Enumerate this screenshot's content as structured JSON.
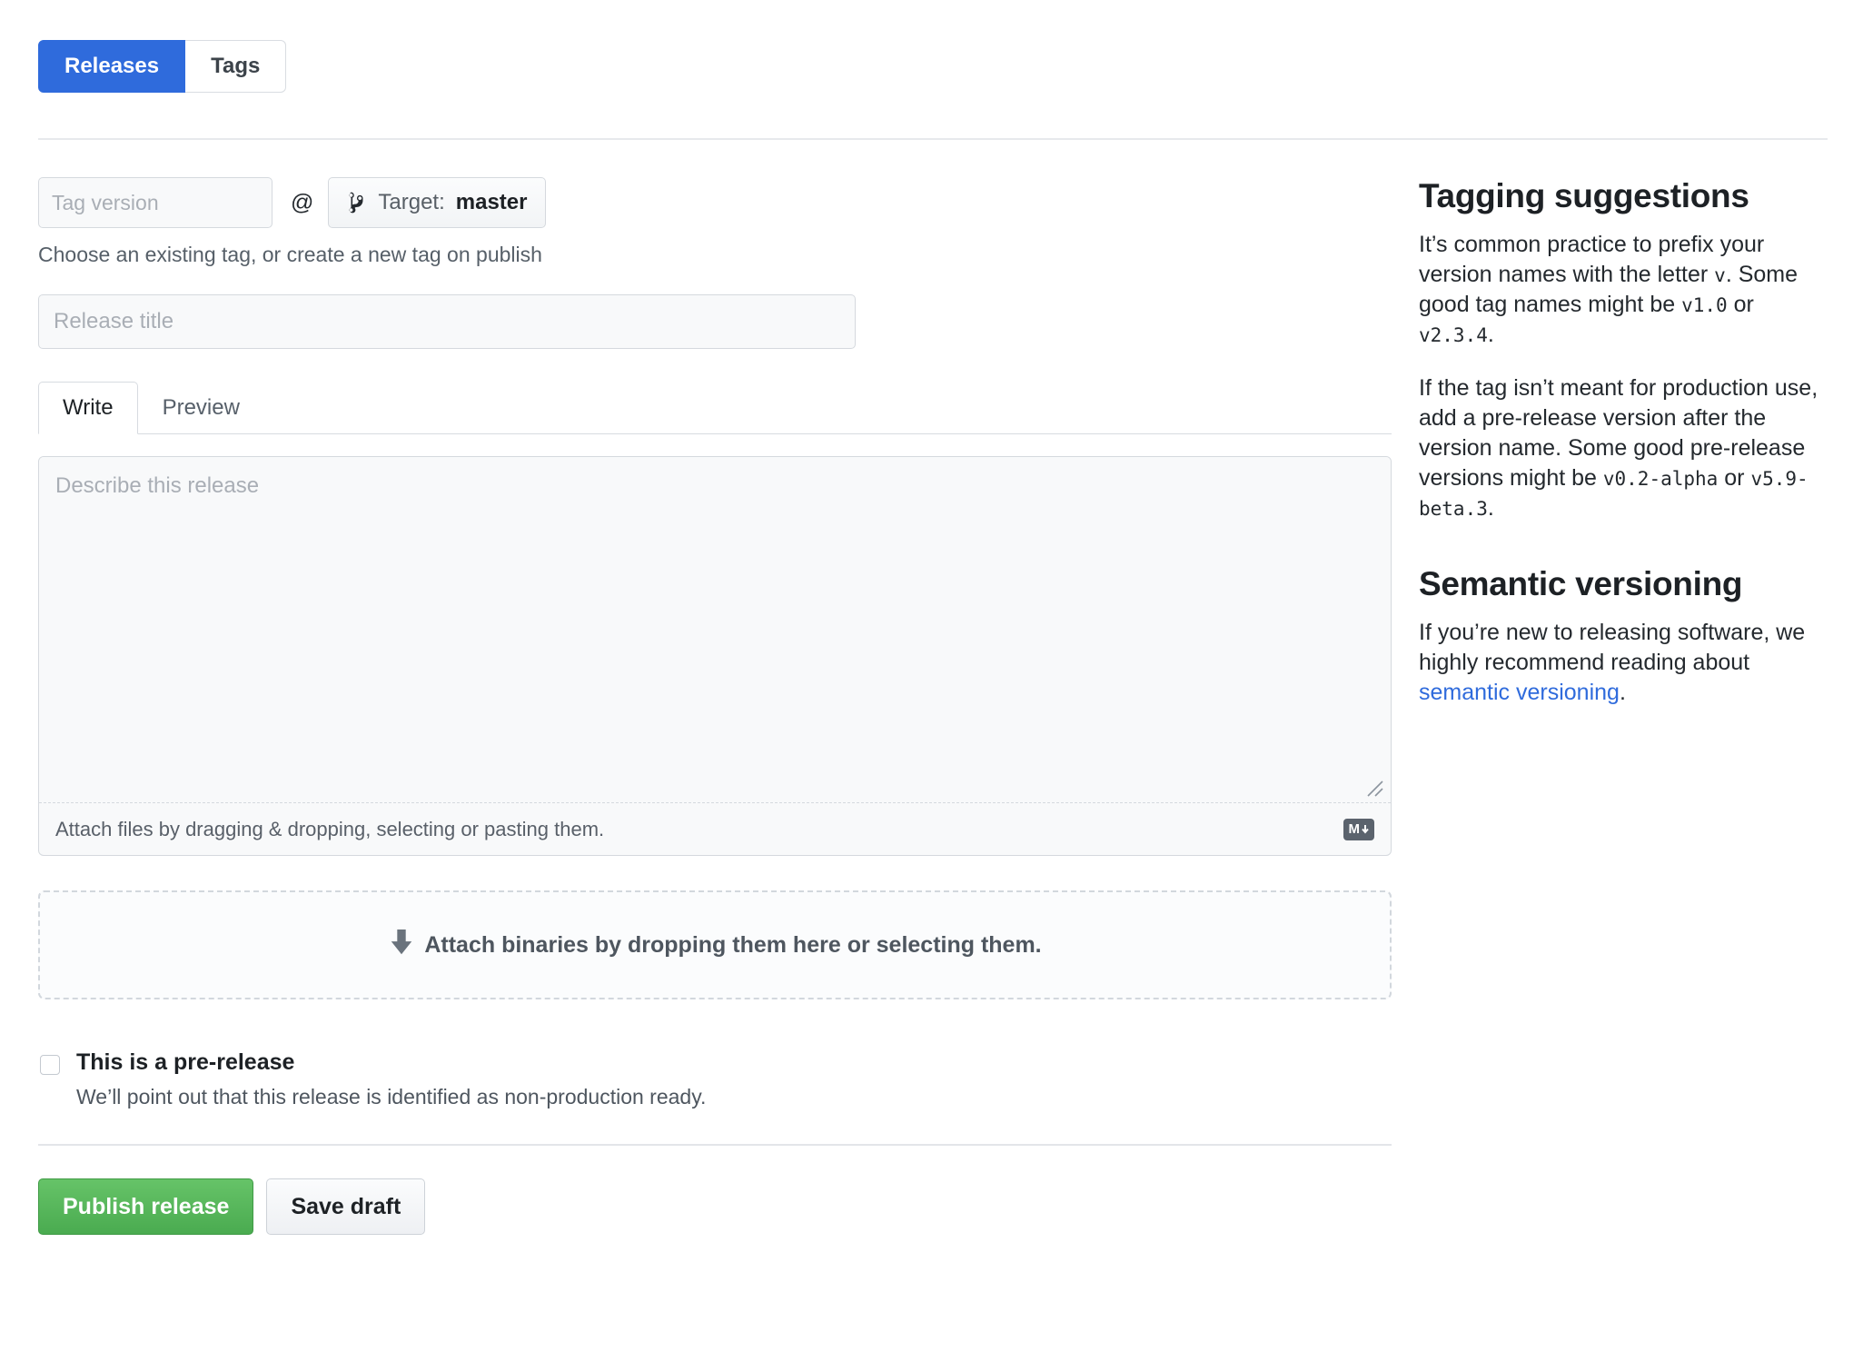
{
  "tabs": {
    "releases_label": "Releases",
    "tags_label": "Tags",
    "active": "Releases"
  },
  "form": {
    "tag_version": {
      "value": "",
      "placeholder": "Tag version"
    },
    "at_symbol": "@",
    "target": {
      "icon": "git-branch-icon",
      "label": "Target:",
      "value": "master"
    },
    "tag_help": "Choose an existing tag, or create a new tag on publish",
    "release_title": {
      "value": "",
      "placeholder": "Release title"
    },
    "editor_tabs": {
      "write_label": "Write",
      "preview_label": "Preview",
      "active": "Write"
    },
    "description": {
      "value": "",
      "placeholder": "Describe this release"
    },
    "attach_hint": "Attach files by dragging & dropping, selecting or pasting them.",
    "markdown_icon_label": "M",
    "dropzone_text": "Attach binaries by dropping them here or selecting them.",
    "prerelease": {
      "checked": false,
      "label": "This is a pre-release",
      "description": "We’ll point out that this release is identified as non-production ready."
    },
    "publish_label": "Publish release",
    "draft_label": "Save draft"
  },
  "sidebar": {
    "tagging": {
      "heading": "Tagging suggestions",
      "p1_a": "It’s common practice to prefix your version names with the letter ",
      "p1_code1": "v",
      "p1_b": ". Some good tag names might be ",
      "p1_code2": "v1.0",
      "p1_c": " or ",
      "p1_code3": "v2.3.4",
      "p1_d": ".",
      "p2_a": "If the tag isn’t meant for production use, add a pre-release version after the version name. Some good pre-release versions might be ",
      "p2_code1": "v0.2-alpha",
      "p2_b": " or ",
      "p2_code2": "v5.9-beta.3",
      "p2_c": "."
    },
    "semver": {
      "heading": "Semantic versioning",
      "p_a": "If you’re new to releasing software, we highly recommend reading about ",
      "link": "semantic versioning",
      "p_b": "."
    }
  },
  "colors": {
    "accent_blue": "#2f6bdc",
    "link_blue": "#2f6bdc",
    "publish_green": "#4aab50",
    "border": "#d5d9de",
    "field_bg": "#f8f9fa"
  }
}
